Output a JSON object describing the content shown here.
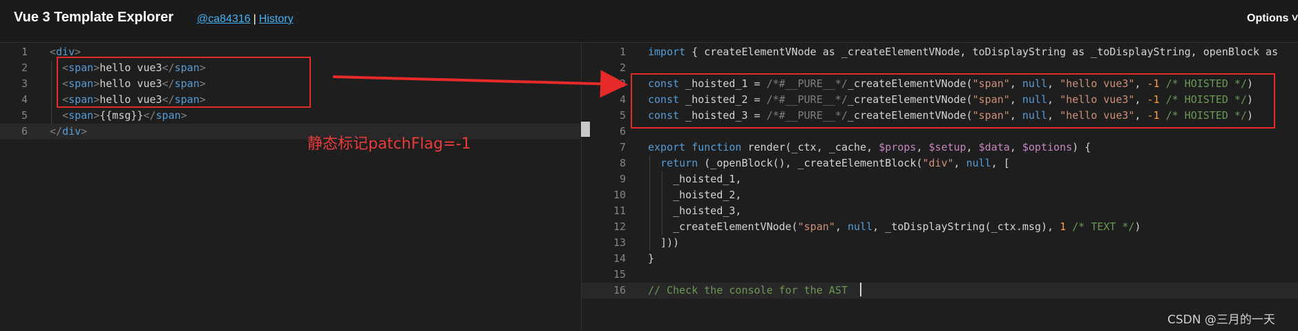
{
  "header": {
    "title": "Vue 3 Template Explorer",
    "commit_link": "@ca84316",
    "separator": "|",
    "history_link": "History",
    "options_label": "Options ˅"
  },
  "template_editor": {
    "lines": [
      {
        "num": "1",
        "tokens": [
          [
            "punc",
            "<"
          ],
          [
            "tag",
            "div"
          ],
          [
            "punc",
            ">"
          ]
        ]
      },
      {
        "num": "2",
        "tokens": [
          [
            "plain",
            "  "
          ],
          [
            "punc",
            "<"
          ],
          [
            "tag",
            "span"
          ],
          [
            "punc",
            ">"
          ],
          [
            "text",
            "hello vue3"
          ],
          [
            "punc",
            "</"
          ],
          [
            "tag",
            "span"
          ],
          [
            "punc",
            ">"
          ]
        ]
      },
      {
        "num": "3",
        "tokens": [
          [
            "plain",
            "  "
          ],
          [
            "punc",
            "<"
          ],
          [
            "tag",
            "span"
          ],
          [
            "punc",
            ">"
          ],
          [
            "text",
            "hello vue3"
          ],
          [
            "punc",
            "</"
          ],
          [
            "tag",
            "span"
          ],
          [
            "punc",
            ">"
          ]
        ]
      },
      {
        "num": "4",
        "tokens": [
          [
            "plain",
            "  "
          ],
          [
            "punc",
            "<"
          ],
          [
            "tag",
            "span"
          ],
          [
            "punc",
            ">"
          ],
          [
            "text",
            "hello vue3"
          ],
          [
            "punc",
            "</"
          ],
          [
            "tag",
            "span"
          ],
          [
            "punc",
            ">"
          ]
        ]
      },
      {
        "num": "5",
        "tokens": [
          [
            "plain",
            "  "
          ],
          [
            "punc",
            "<"
          ],
          [
            "tag",
            "span"
          ],
          [
            "punc",
            ">"
          ],
          [
            "text",
            "{{msg}}"
          ],
          [
            "punc",
            "</"
          ],
          [
            "tag",
            "span"
          ],
          [
            "punc",
            ">"
          ]
        ]
      },
      {
        "num": "6",
        "tokens": [
          [
            "punc",
            "</"
          ],
          [
            "tag",
            "div"
          ],
          [
            "punc",
            ">"
          ]
        ]
      }
    ]
  },
  "compiled_output": {
    "lines": [
      {
        "num": "1",
        "tokens": [
          [
            "kw",
            "import"
          ],
          [
            "plain",
            " { createElementVNode as _createElementVNode, toDisplayString as _toDisplayString, openBlock as"
          ]
        ]
      },
      {
        "num": "2",
        "tokens": []
      },
      {
        "num": "3",
        "tokens": [
          [
            "kw",
            "const"
          ],
          [
            "plain",
            " _hoisted_1 = "
          ],
          [
            "grey",
            "/*#__PURE__*/"
          ],
          [
            "plain",
            "_createElementVNode("
          ],
          [
            "str",
            "\"span\""
          ],
          [
            "plain",
            ", "
          ],
          [
            "kw",
            "null"
          ],
          [
            "plain",
            ", "
          ],
          [
            "str",
            "\"hello vue3\""
          ],
          [
            "plain",
            ", "
          ],
          [
            "num",
            "-1"
          ],
          [
            "cmt",
            " /* HOISTED */"
          ],
          [
            "plain",
            ")"
          ]
        ]
      },
      {
        "num": "4",
        "tokens": [
          [
            "kw",
            "const"
          ],
          [
            "plain",
            " _hoisted_2 = "
          ],
          [
            "grey",
            "/*#__PURE__*/"
          ],
          [
            "plain",
            "_createElementVNode("
          ],
          [
            "str",
            "\"span\""
          ],
          [
            "plain",
            ", "
          ],
          [
            "kw",
            "null"
          ],
          [
            "plain",
            ", "
          ],
          [
            "str",
            "\"hello vue3\""
          ],
          [
            "plain",
            ", "
          ],
          [
            "num",
            "-1"
          ],
          [
            "cmt",
            " /* HOISTED */"
          ],
          [
            "plain",
            ")"
          ]
        ]
      },
      {
        "num": "5",
        "tokens": [
          [
            "kw",
            "const"
          ],
          [
            "plain",
            " _hoisted_3 = "
          ],
          [
            "grey",
            "/*#__PURE__*/"
          ],
          [
            "plain",
            "_createElementVNode("
          ],
          [
            "str",
            "\"span\""
          ],
          [
            "plain",
            ", "
          ],
          [
            "kw",
            "null"
          ],
          [
            "plain",
            ", "
          ],
          [
            "str",
            "\"hello vue3\""
          ],
          [
            "plain",
            ", "
          ],
          [
            "num",
            "-1"
          ],
          [
            "cmt",
            " /* HOISTED */"
          ],
          [
            "plain",
            ")"
          ]
        ]
      },
      {
        "num": "6",
        "tokens": []
      },
      {
        "num": "7",
        "tokens": [
          [
            "kw",
            "export function"
          ],
          [
            "plain",
            " render(_ctx, _cache, "
          ],
          [
            "var",
            "$props"
          ],
          [
            "plain",
            ", "
          ],
          [
            "var",
            "$setup"
          ],
          [
            "plain",
            ", "
          ],
          [
            "var",
            "$data"
          ],
          [
            "plain",
            ", "
          ],
          [
            "var",
            "$options"
          ],
          [
            "plain",
            ") {"
          ]
        ]
      },
      {
        "num": "8",
        "tokens": [
          [
            "plain",
            "  "
          ],
          [
            "kw",
            "return"
          ],
          [
            "plain",
            " (_openBlock(), _createElementBlock("
          ],
          [
            "str",
            "\"div\""
          ],
          [
            "plain",
            ", "
          ],
          [
            "kw",
            "null"
          ],
          [
            "plain",
            ", ["
          ]
        ]
      },
      {
        "num": "9",
        "tokens": [
          [
            "plain",
            "    _hoisted_1,"
          ]
        ]
      },
      {
        "num": "10",
        "tokens": [
          [
            "plain",
            "    _hoisted_2,"
          ]
        ]
      },
      {
        "num": "11",
        "tokens": [
          [
            "plain",
            "    _hoisted_3,"
          ]
        ]
      },
      {
        "num": "12",
        "tokens": [
          [
            "plain",
            "    _createElementVNode("
          ],
          [
            "str",
            "\"span\""
          ],
          [
            "plain",
            ", "
          ],
          [
            "kw",
            "null"
          ],
          [
            "plain",
            ", _toDisplayString(_ctx.msg), "
          ],
          [
            "num",
            "1"
          ],
          [
            "cmt",
            " /* TEXT */"
          ],
          [
            "plain",
            ")"
          ]
        ]
      },
      {
        "num": "13",
        "tokens": [
          [
            "plain",
            "  ]))"
          ]
        ]
      },
      {
        "num": "14",
        "tokens": [
          [
            "plain",
            "}"
          ]
        ]
      },
      {
        "num": "15",
        "tokens": []
      },
      {
        "num": "16",
        "tokens": [
          [
            "cmt",
            "// Check the console for the AST"
          ]
        ]
      }
    ]
  },
  "annotation": {
    "label": "静态标记patchFlag=-1",
    "color": "#e62a2a"
  },
  "watermark": "CSDN @三月的一天",
  "colors": {
    "background": "#1e1e1e",
    "link": "#42b3f5",
    "keyword": "#569cd6",
    "string": "#ce9178",
    "number": "#ff9f43",
    "comment": "#6a9955"
  }
}
